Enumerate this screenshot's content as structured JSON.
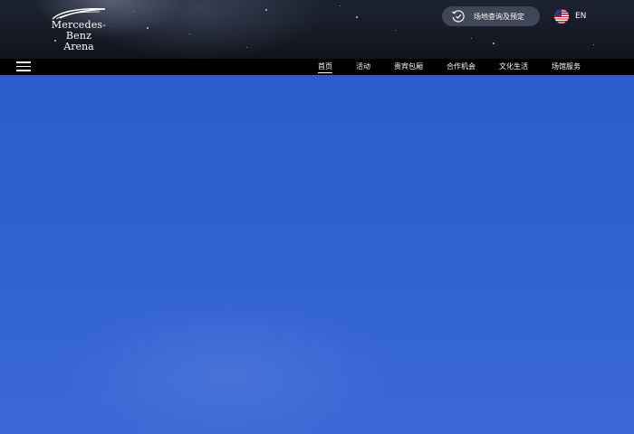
{
  "header": {
    "logo": {
      "line1": "Mercedes-Benz",
      "line2": "Arena"
    },
    "booking_button": {
      "label": "场地查询及预定",
      "icon": "history-clock-icon"
    },
    "language": {
      "label": "EN",
      "flag_icon": "us-flag-icon"
    }
  },
  "nav": {
    "menu_icon": "hamburger-menu-icon",
    "items": [
      {
        "label": "首页",
        "active": true
      },
      {
        "label": "活动",
        "active": false
      },
      {
        "label": "贵宾包厢",
        "active": false
      },
      {
        "label": "合作机会",
        "active": false
      },
      {
        "label": "文化生活",
        "active": false
      },
      {
        "label": "场馆服务",
        "active": false
      }
    ]
  },
  "colors": {
    "header_bg": "#151a25",
    "nav_bg": "#000000",
    "hero_blue": "#3262d2",
    "text": "#ffffff"
  }
}
